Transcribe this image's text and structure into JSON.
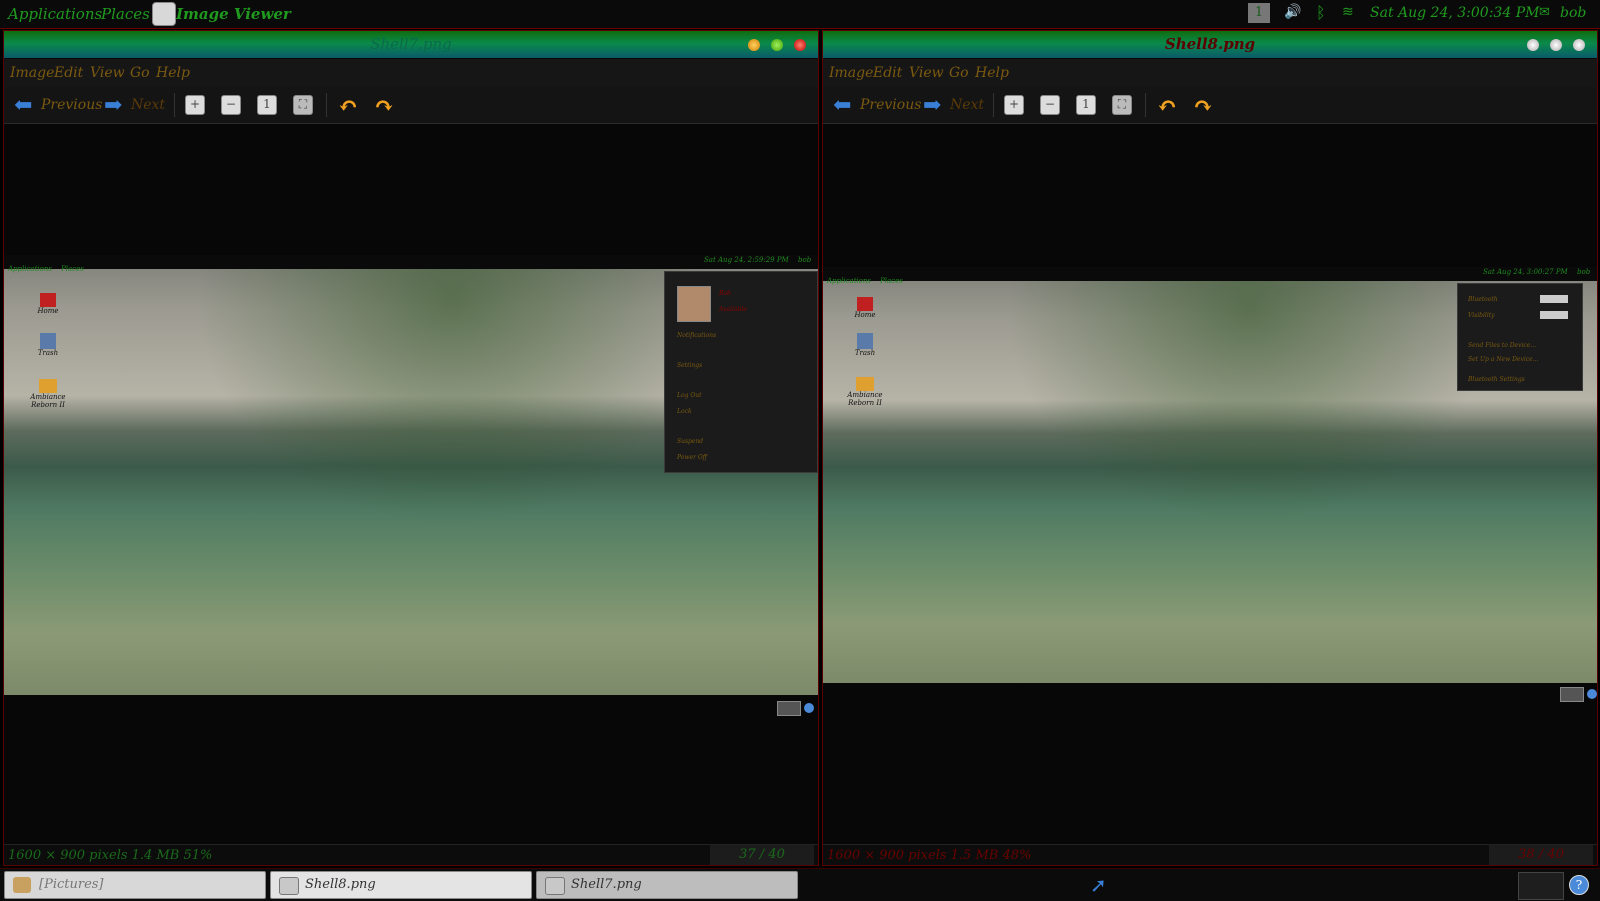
{
  "top_panel": {
    "applications": "Applications",
    "places": "Places",
    "app_title": "Image Viewer",
    "workspace": "1",
    "clock": "Sat Aug 24, 3:00:34 PM",
    "user": "bob"
  },
  "left_window": {
    "title": "Shell7.png",
    "menu": [
      "Image",
      "Edit",
      "View",
      "Go",
      "Help"
    ],
    "toolbar": {
      "previous": "Previous",
      "next": "Next"
    },
    "status": "1600 × 900 pixels  1.4 MB   51%",
    "counter": "37 / 40",
    "mini_panel": {
      "applications": "Applications",
      "places": "Places",
      "clock": "Sat Aug 24, 2:59:29 PM",
      "user": "bob"
    },
    "desktop_icons": [
      "Home",
      "Trash",
      "Ambiance Reborn II"
    ],
    "popup": [
      "Bob",
      "Available",
      "Notifications",
      "Settings",
      "Log Out",
      "Lock",
      "Suspend",
      "Power Off"
    ]
  },
  "right_window": {
    "title": "Shell8.png",
    "menu": [
      "Image",
      "Edit",
      "View",
      "Go",
      "Help"
    ],
    "toolbar": {
      "previous": "Previous",
      "next": "Next"
    },
    "status": "1600 × 900 pixels  1.5 MB   48%",
    "counter": "38 / 40",
    "mini_panel": {
      "applications": "Applications",
      "places": "Places",
      "clock": "Sat Aug 24, 3:00:27 PM",
      "user": "bob"
    },
    "desktop_icons": [
      "Home",
      "Trash",
      "Ambiance Reborn II"
    ],
    "popup": [
      "Bluetooth",
      "Visibility",
      "Send Files to Device...",
      "Set Up a New Device...",
      "Bluetooth Settings"
    ]
  },
  "taskbar": [
    {
      "label": "[Pictures]",
      "icon": "folder-icon"
    },
    {
      "label": "Shell8.png",
      "icon": "image-viewer-icon"
    },
    {
      "label": "Shell7.png",
      "icon": "image-viewer-icon"
    }
  ],
  "colors": {
    "accent_green": "#1f9a1f",
    "menu_brown": "#7b5a10",
    "alert_red": "#8a0000"
  }
}
